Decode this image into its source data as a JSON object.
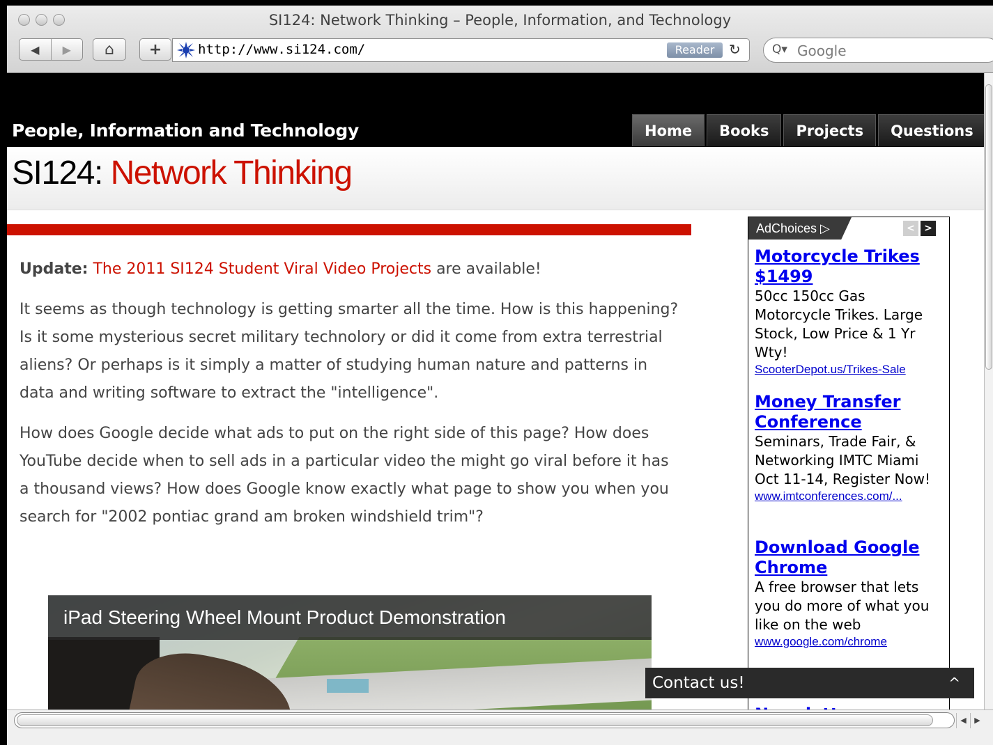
{
  "browser": {
    "window_title": "SI124: Network Thinking – People, Information, and Technology",
    "url": "http://www.si124.com/",
    "reader_label": "Reader",
    "search_placeholder": "Google",
    "nav_back_glyph": "◀",
    "nav_forward_glyph": "▶",
    "home_glyph": "⌂",
    "add_glyph": "+",
    "reload_glyph": "↻",
    "search_glyph": "Q▾"
  },
  "site": {
    "name": "People, Information and Technology",
    "tabs": [
      {
        "label": "Home",
        "active": true
      },
      {
        "label": "Books",
        "active": false
      },
      {
        "label": "Projects",
        "active": false
      },
      {
        "label": "Questions",
        "active": false
      }
    ],
    "title_prefix": "SI124:",
    "title_highlight": "Network Thinking",
    "accent_color": "#cc1100"
  },
  "article": {
    "update_label": "Update:",
    "update_link": "The 2011 SI124 Student Viral Video Projects",
    "update_suffix": "are available!",
    "paragraph1": "It seems as though technology is getting smarter all the time. How is this happening? Is it some mysterious secret military technolory or did it come from extra terrestrial aliens? Or perhaps is it simply a matter of studying human nature and patterns in data and writing software to extract the \"intelligence\".",
    "paragraph2": "How does Google decide what ads to put on the right side of this page? How does YouTube decide when to sell ads in a particular video the might go viral before it has a thousand views? How does Google know exactly what page to show you when you search for \"2002 pontiac grand am broken windshield trim\"?",
    "video_title": "iPad Steering Wheel Mount Product Demonstration"
  },
  "ads": {
    "adchoices_label": "AdChoices ▷",
    "prev_glyph": "<",
    "next_glyph": ">",
    "items": [
      {
        "headline": "Motorcycle Trikes $1499",
        "description": "50cc 150cc Gas Motorcycle Trikes. Large Stock, Low Price & 1 Yr Wty!",
        "url": "ScooterDepot.us/Trikes-Sale"
      },
      {
        "headline": "Money Transfer Conference",
        "description": "Seminars, Trade Fair, & Networking IMTC Miami Oct 11-14, Register Now!",
        "url": "www.imtconferences.com/..."
      },
      {
        "headline": "Download Google Chrome",
        "description": "A free browser that lets you do more of what you like on the web",
        "url": "www.google.com/chrome"
      },
      {
        "headline": "Newsletter"
      }
    ]
  },
  "contact": {
    "label": "Contact us!",
    "caret_glyph": "^"
  }
}
